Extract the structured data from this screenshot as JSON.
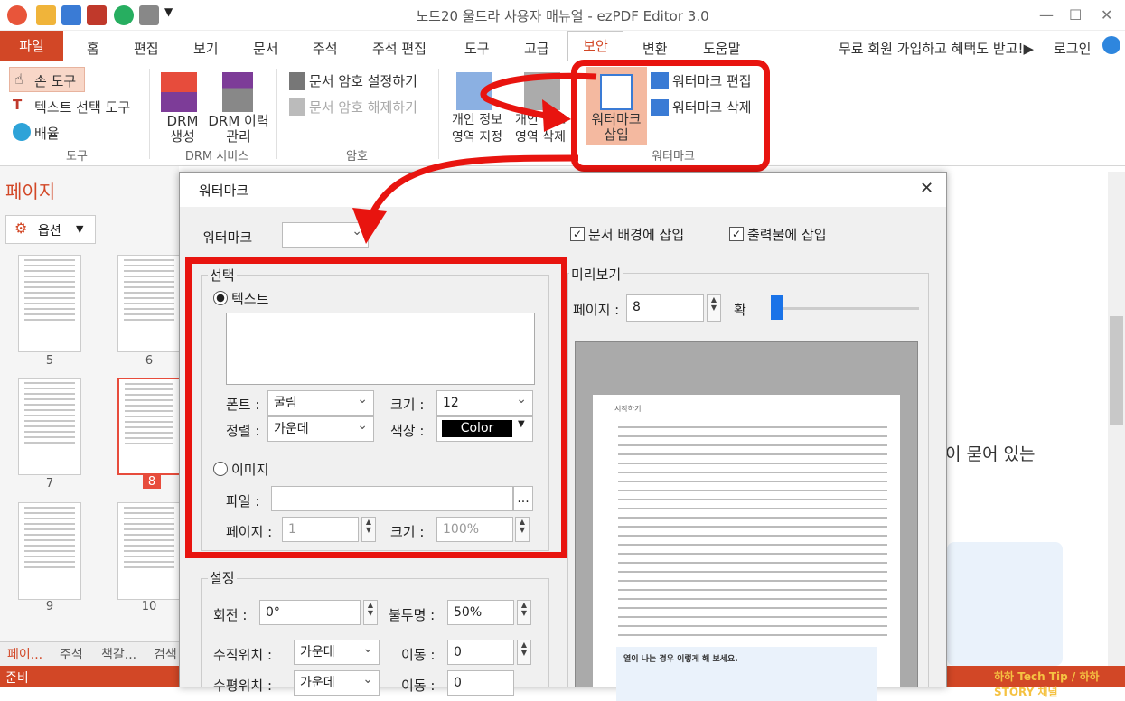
{
  "window": {
    "title": "노트20 울트라 사용자 매뉴얼 - ezPDF Editor 3.0"
  },
  "menu": {
    "file": "파일",
    "tabs": [
      "홈",
      "편집",
      "보기",
      "문서",
      "주석",
      "주석 편집",
      "도구",
      "고급",
      "보안",
      "변환",
      "도움말"
    ],
    "active": "보안",
    "promo": "무료 회원 가입하고 혜택도 받고!▶",
    "login": "로그인"
  },
  "ribbon": {
    "hand_tool": "손 도구",
    "text_select_tool": "텍스트 선택 도구",
    "zoom": "배율",
    "group_tools": "도구",
    "drm_create": "DRM 생성",
    "drm_history": "DRM 이력 관리",
    "group_drm": "DRM 서비스",
    "pw_set": "문서 암호 설정하기",
    "pw_remove": "문서 암호 해제하기",
    "group_password": "암호",
    "privacy_set": "개인 정보 영역 지정",
    "privacy_delete": "개인 정보 영역 삭제",
    "wm_insert": "워터마크 삽입",
    "wm_edit": "워터마크 편집",
    "wm_delete": "워터마크 삭제",
    "group_watermark": "워터마크"
  },
  "leftpane": {
    "title": "페이지",
    "options": "옵션",
    "pages": [
      "5",
      "6",
      "7",
      "8",
      "9",
      "10"
    ],
    "selected": "8",
    "bottom_tabs": [
      "페이...",
      "주석",
      "책갈...",
      "검색"
    ]
  },
  "status": {
    "text": "준비",
    "watermark": "하하 Tech Tip / 하하 STORY 채널"
  },
  "doc_text": "이 묻어 있는",
  "dialog": {
    "title": "워터마크",
    "wm_label": "워터마크",
    "bg_insert": "문서 배경에 삽입",
    "print_insert": "출력물에 삽입",
    "select_group": "선택",
    "text_radio": "텍스트",
    "font_label": "폰트 :",
    "font_value": "굴림",
    "size_label": "크기 :",
    "size_value": "12",
    "align_label": "정렬 :",
    "align_value": "가운데",
    "color_label": "색상 :",
    "color_value": "Color",
    "image_radio": "이미지",
    "file_label": "파일 :",
    "page_label": "페이지 :",
    "page_value": "1",
    "img_size_label": "크기 :",
    "img_size_value": "100%",
    "browse": "...",
    "settings_group": "설정",
    "rotate_label": "회전 :",
    "rotate_value": "0°",
    "opacity_label": "불투명 :",
    "opacity_value": "50%",
    "vpos_label": "수직위치 :",
    "vpos_value": "가운데",
    "move_label": "이동 :",
    "move_value": "0",
    "hpos_label": "수평위치 :",
    "hpos_value": "가운데",
    "move2_label": "이동 :",
    "move2_value": "0",
    "preview_group": "미리보기",
    "prev_page_label": "페이지 :",
    "prev_page_value": "8",
    "zoom_label": "확",
    "preview_heading": "시작하기",
    "preview_box_title": "열이 나는 경우 이렇게 해 보세요."
  },
  "colors": {
    "accent": "#d24726",
    "annotation": "#e8140f"
  }
}
